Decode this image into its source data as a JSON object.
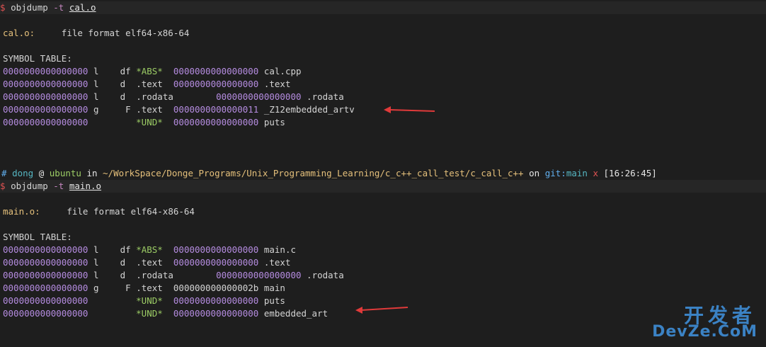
{
  "block1": {
    "prompt_symbol": "$",
    "command": "objdump",
    "flag": "-t",
    "file": "cal.o",
    "file_line_name": "cal.o:",
    "file_format": "file format elf64-x86-64",
    "symbol_table_label": "SYMBOL TABLE:",
    "rows": [
      {
        "addr": "0000000000000000",
        "bind": "l",
        "type": "df",
        "section": "*ABS*",
        "size": "0000000000000000",
        "name": "cal.cpp"
      },
      {
        "addr": "0000000000000000",
        "bind": "l",
        "type": "d",
        "section": ".text",
        "size": "0000000000000000",
        "name": ".text"
      },
      {
        "addr": "0000000000000000",
        "bind": "l",
        "type": "d",
        "section": ".rodata",
        "size": "0000000000000000",
        "name": ".rodata"
      },
      {
        "addr": "0000000000000000",
        "bind": "g",
        "type": "F",
        "section": ".text",
        "size": "0000000000000011",
        "name": "_Z12embedded_artv"
      },
      {
        "addr": "0000000000000000",
        "bind": "",
        "type": "",
        "section": "*UND*",
        "size": "0000000000000000",
        "name": "puts"
      }
    ]
  },
  "prompt": {
    "hash": "#",
    "user": "dong",
    "at": "@",
    "host": "ubuntu",
    "in": "in",
    "path": "~/WorkSpace/Donge_Programs/Unix_Programming_Learning/c_c++_call_test/c_call_c++",
    "on": "on",
    "git": "git:",
    "branch": "main",
    "x": "x",
    "time": "[16:26:45]"
  },
  "block2": {
    "prompt_symbol": "$",
    "command": "objdump",
    "flag": "-t",
    "file": "main.o",
    "file_line_name": "main.o:",
    "file_format": "file format elf64-x86-64",
    "symbol_table_label": "SYMBOL TABLE:",
    "rows": [
      {
        "addr": "0000000000000000",
        "bind": "l",
        "type": "df",
        "section": "*ABS*",
        "size": "0000000000000000",
        "name": "main.c"
      },
      {
        "addr": "0000000000000000",
        "bind": "l",
        "type": "d",
        "section": ".text",
        "size": "0000000000000000",
        "name": ".text"
      },
      {
        "addr": "0000000000000000",
        "bind": "l",
        "type": "d",
        "section": ".rodata",
        "size": "0000000000000000",
        "name": ".rodata"
      },
      {
        "addr": "0000000000000000",
        "bind": "g",
        "type": "F",
        "section": ".text",
        "size": "000000000000002b",
        "name": "main"
      },
      {
        "addr": "0000000000000000",
        "bind": "",
        "type": "",
        "section": "*UND*",
        "size": "0000000000000000",
        "name": "puts"
      },
      {
        "addr": "0000000000000000",
        "bind": "",
        "type": "",
        "section": "*UND*",
        "size": "0000000000000000",
        "name": "embedded_art"
      }
    ]
  },
  "watermark": {
    "cn": "开发者",
    "en": "DevZe.CoM"
  },
  "colors": {
    "background": "#1e1e1e",
    "addr_purple": "#b58ce0",
    "arrow_red": "#e03a3a",
    "watermark_blue": "#3b82c4"
  }
}
